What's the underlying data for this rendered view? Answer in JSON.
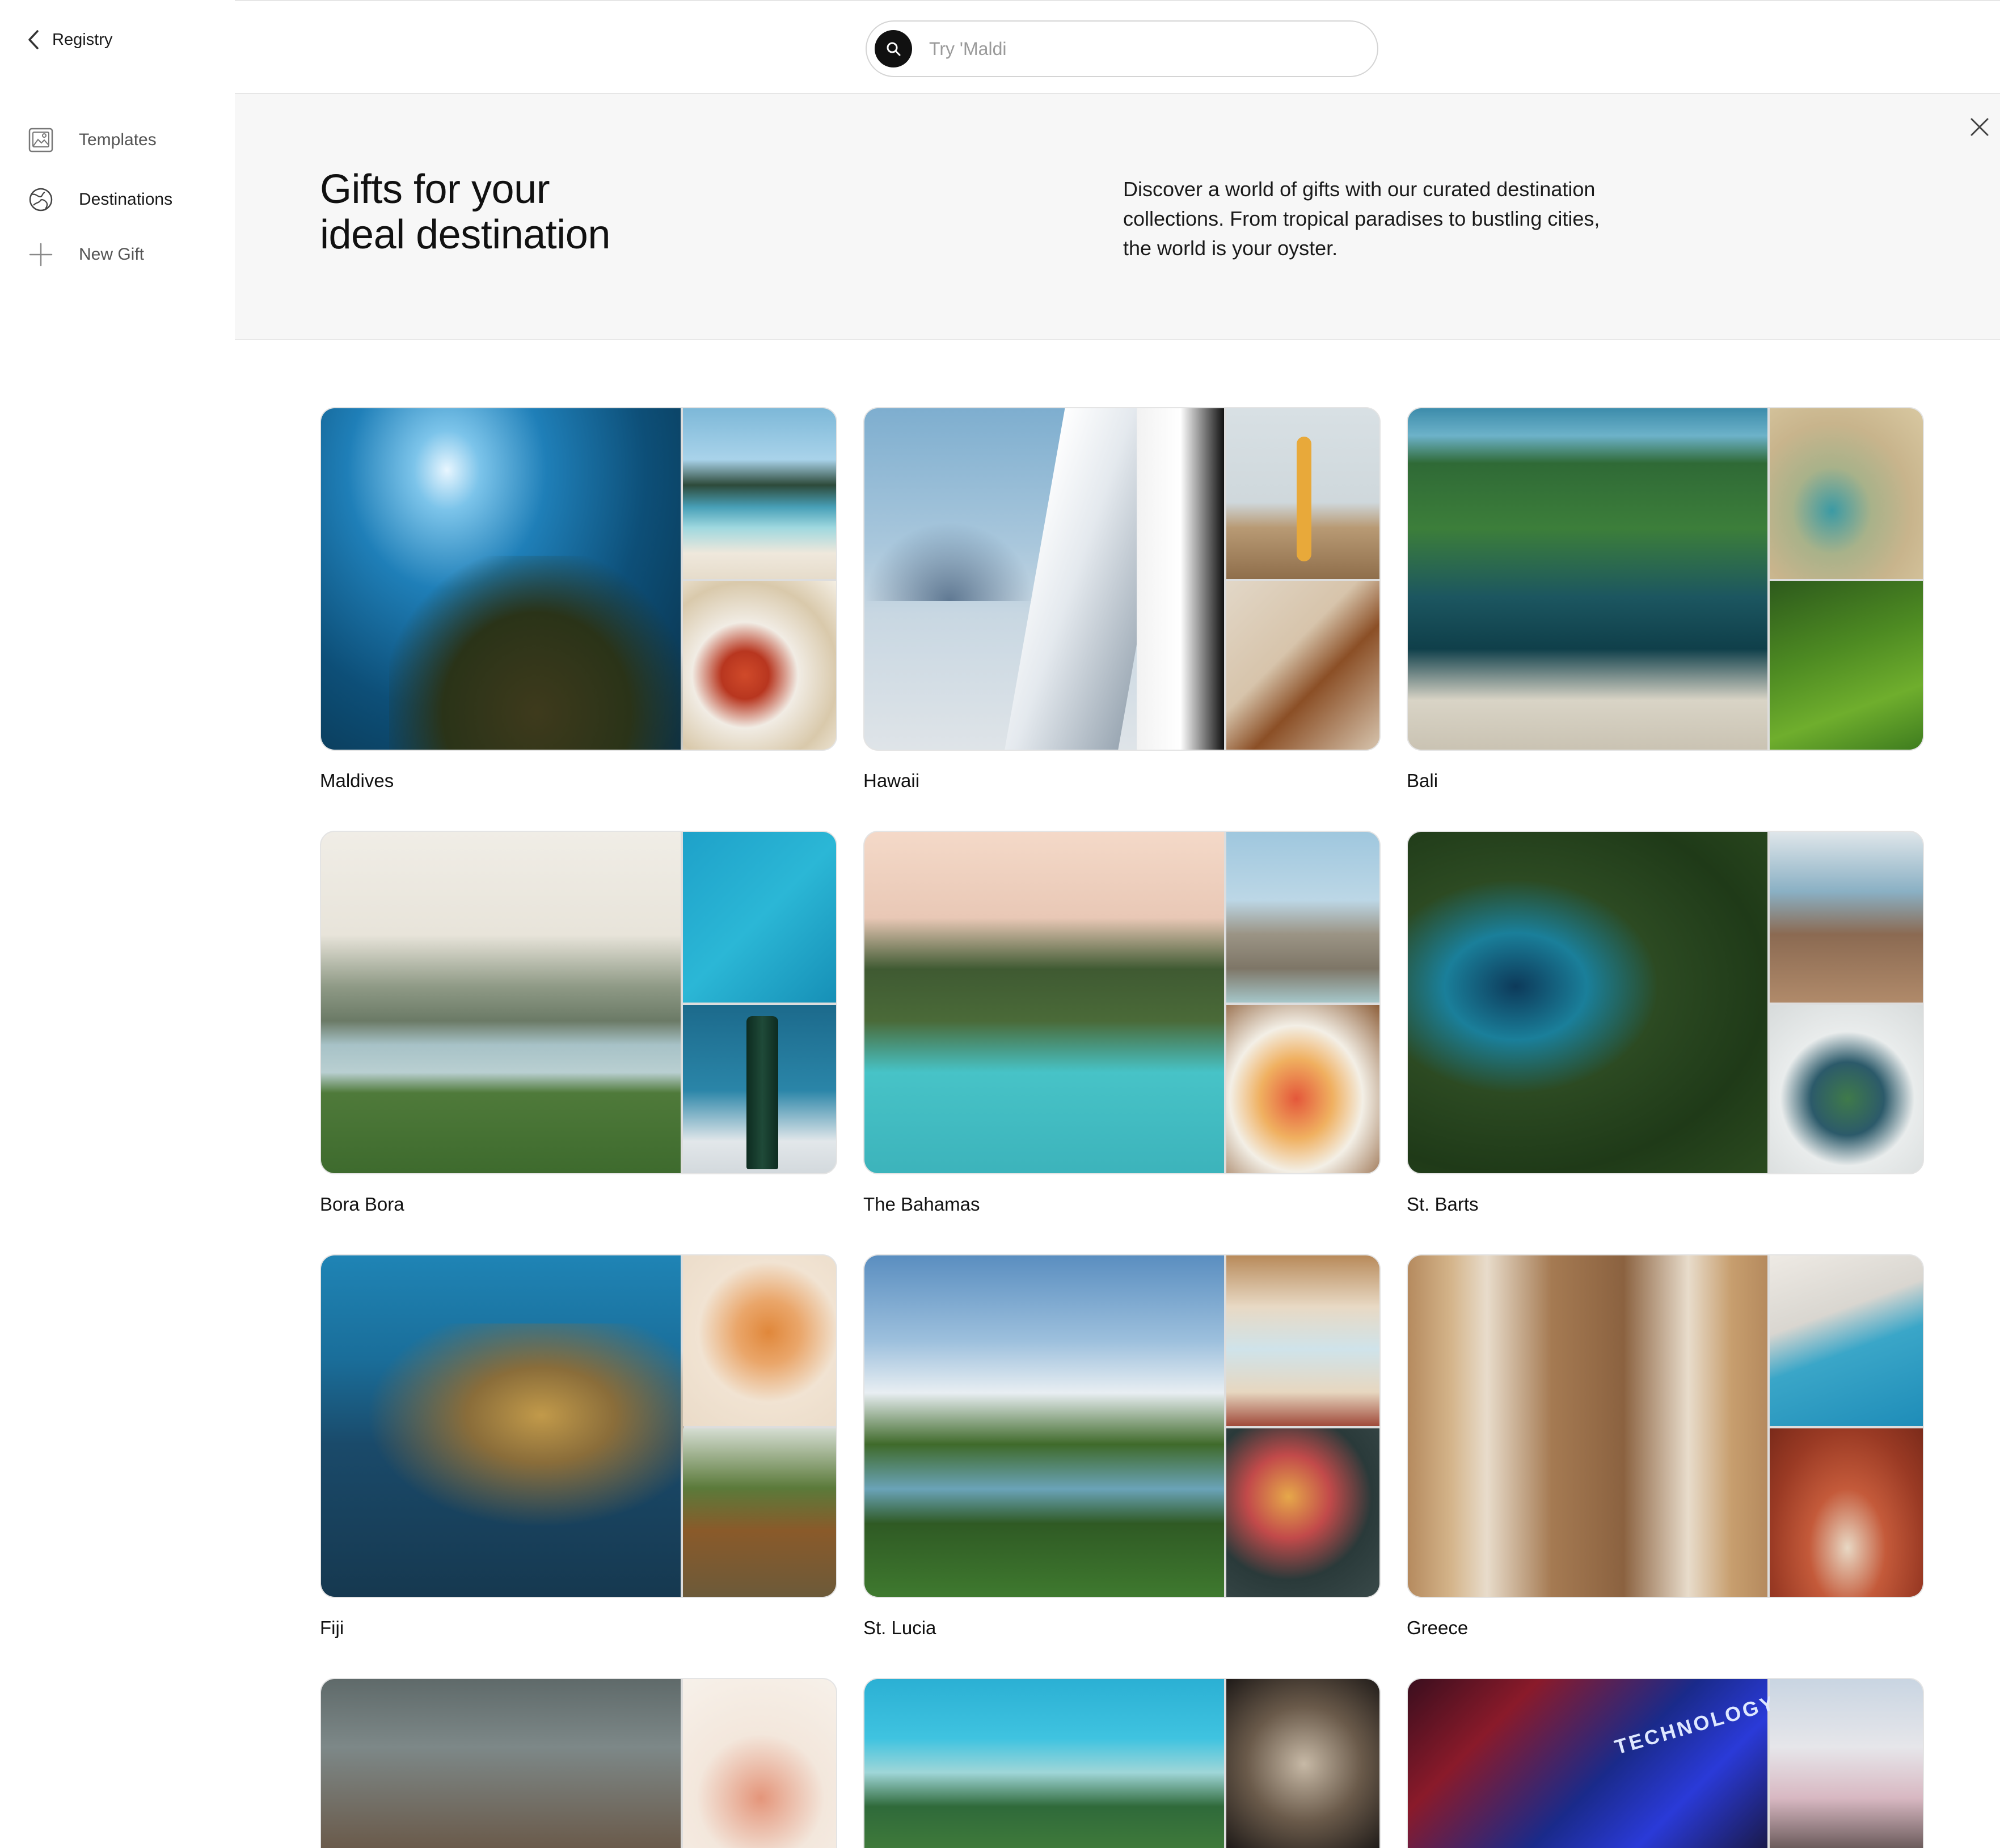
{
  "sidebar": {
    "back_label": "Registry",
    "items": [
      {
        "label": "Templates",
        "icon": "image-icon",
        "active": false
      },
      {
        "label": "Destinations",
        "icon": "globe-icon",
        "active": true
      },
      {
        "label": "New Gift",
        "icon": "plus-icon",
        "active": false
      }
    ]
  },
  "search": {
    "placeholder": "Try 'Maldi",
    "value": ""
  },
  "hero": {
    "title_line1": "Gifts for your",
    "title_line2": "ideal destination",
    "description": "Discover a world of gifts with our curated destination collections. From tropical paradises to bustling cities, the world is your oyster."
  },
  "destinations": [
    {
      "name": "Maldives"
    },
    {
      "name": "Hawaii"
    },
    {
      "name": "Bali"
    },
    {
      "name": "Bora Bora"
    },
    {
      "name": "The Bahamas"
    },
    {
      "name": "St. Barts"
    },
    {
      "name": "Fiji"
    },
    {
      "name": "St. Lucia"
    },
    {
      "name": "Greece"
    }
  ],
  "partial_row_text": [
    "TECHNOLOGY"
  ],
  "colors": {
    "accent": "#111111",
    "hero_bg": "#f7f7f7",
    "border": "#e6e6e6"
  }
}
